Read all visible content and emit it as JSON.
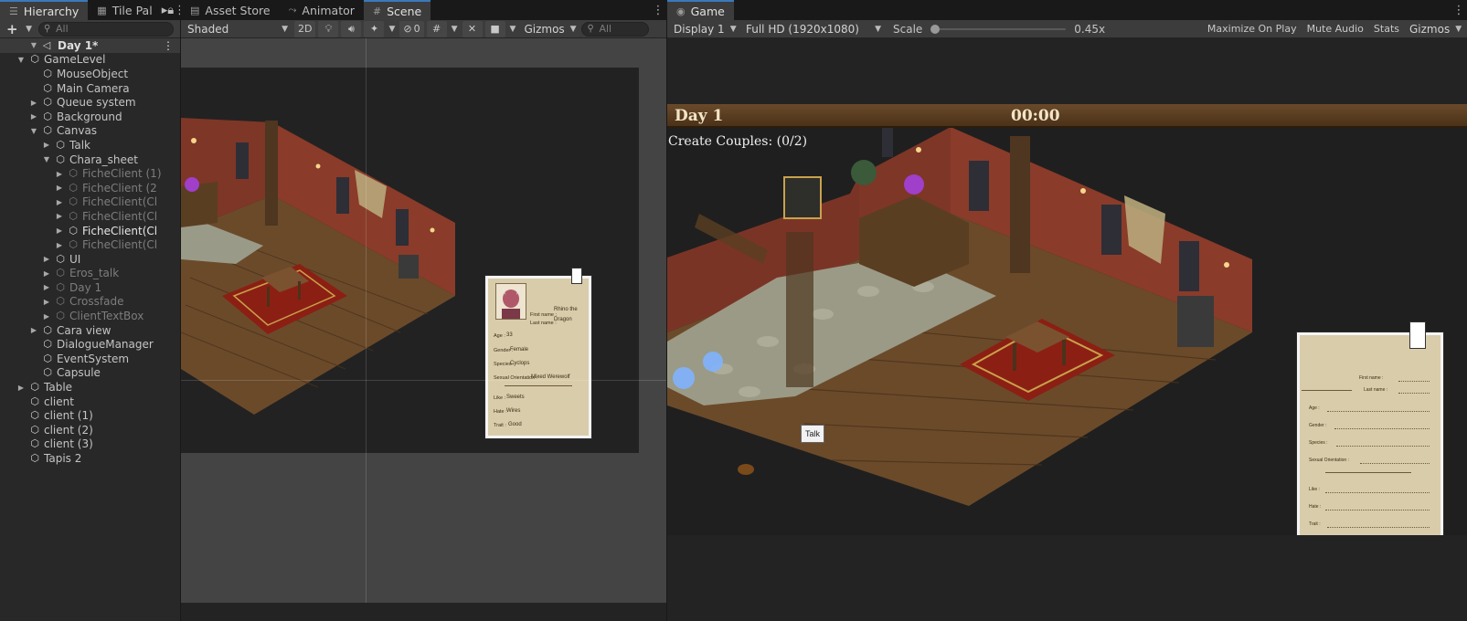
{
  "hierarchy": {
    "tabs": [
      {
        "label": "Hierarchy",
        "icon": "list-icon"
      },
      {
        "label": "Tile Pal",
        "icon": "grid-icon"
      }
    ],
    "add_label": "+",
    "search_placeholder": "All",
    "scene_name": "Day 1*",
    "rows": [
      {
        "label": "GameLevel",
        "depth": 1,
        "expand": "open",
        "state": "normal"
      },
      {
        "label": "MouseObject",
        "depth": 2,
        "expand": "none",
        "state": "normal"
      },
      {
        "label": "Main Camera",
        "depth": 2,
        "expand": "none",
        "state": "normal"
      },
      {
        "label": "Queue system",
        "depth": 2,
        "expand": "closed",
        "state": "normal"
      },
      {
        "label": "Background",
        "depth": 2,
        "expand": "closed",
        "state": "normal"
      },
      {
        "label": "Canvas",
        "depth": 2,
        "expand": "open",
        "state": "normal"
      },
      {
        "label": "Talk",
        "depth": 3,
        "expand": "closed",
        "state": "normal"
      },
      {
        "label": "Chara_sheet",
        "depth": 3,
        "expand": "open",
        "state": "normal"
      },
      {
        "label": "FicheClient (1)",
        "depth": 4,
        "expand": "closed",
        "state": "dim"
      },
      {
        "label": "FicheClient (2",
        "depth": 4,
        "expand": "closed",
        "state": "dim"
      },
      {
        "label": "FicheClient(Cl",
        "depth": 4,
        "expand": "closed",
        "state": "dim"
      },
      {
        "label": "FicheClient(Cl",
        "depth": 4,
        "expand": "closed",
        "state": "dim"
      },
      {
        "label": "FicheClient(Cl",
        "depth": 4,
        "expand": "closed",
        "state": "bright"
      },
      {
        "label": "FicheClient(Cl",
        "depth": 4,
        "expand": "closed",
        "state": "dim"
      },
      {
        "label": "UI",
        "depth": 3,
        "expand": "closed",
        "state": "normal"
      },
      {
        "label": "Eros_talk",
        "depth": 3,
        "expand": "closed",
        "state": "dim"
      },
      {
        "label": "Day 1",
        "depth": 3,
        "expand": "closed",
        "state": "dim"
      },
      {
        "label": "Crossfade",
        "depth": 3,
        "expand": "closed",
        "state": "dim"
      },
      {
        "label": "ClientTextBox",
        "depth": 3,
        "expand": "closed",
        "state": "dim"
      },
      {
        "label": "Cara view",
        "depth": 2,
        "expand": "closed",
        "state": "normal"
      },
      {
        "label": "DialogueManager",
        "depth": 2,
        "expand": "none",
        "state": "normal"
      },
      {
        "label": "EventSystem",
        "depth": 2,
        "expand": "none",
        "state": "normal"
      },
      {
        "label": "Capsule",
        "depth": 2,
        "expand": "none",
        "state": "normal"
      },
      {
        "label": "Table",
        "depth": 1,
        "expand": "closed",
        "state": "normal"
      },
      {
        "label": "client",
        "depth": 1,
        "expand": "none",
        "state": "normal"
      },
      {
        "label": "client (1)",
        "depth": 1,
        "expand": "none",
        "state": "normal"
      },
      {
        "label": "client (2)",
        "depth": 1,
        "expand": "none",
        "state": "normal"
      },
      {
        "label": "client (3)",
        "depth": 1,
        "expand": "none",
        "state": "normal"
      },
      {
        "label": "Tapis 2",
        "depth": 1,
        "expand": "none",
        "state": "normal"
      }
    ]
  },
  "scene": {
    "tabs": [
      {
        "label": "Asset Store",
        "icon": "store-icon"
      },
      {
        "label": "Animator",
        "icon": "animator-icon"
      },
      {
        "label": "Scene",
        "icon": "scene-grid-icon"
      }
    ],
    "shading_mode": "Shaded",
    "mode_2d_label": "2D",
    "hidden_count": "0",
    "gizmos_label": "Gizmos",
    "search_placeholder": "All",
    "sheet": {
      "first_name_label": "First name :",
      "first_name_value": "Rhino the",
      "last_name_label": "Last name :",
      "last_name_value": "Dragon",
      "age_label": "Age :",
      "age_value": "33",
      "gender_label": "Gender :",
      "gender_value": "Female",
      "species_label": "Species :",
      "species_value": "Cyclops",
      "orientation_label": "Sexual Orientation :",
      "orientation_value": "Mixed Werewolf",
      "like_label": "Like :",
      "like_value": "Sweets",
      "hate_label": "Hate :",
      "hate_value": "Wires",
      "trait_label": "Trait :",
      "trait_value": "Good"
    }
  },
  "game": {
    "tab_label": "Game",
    "display_label": "Display 1",
    "resolution_label": "Full HD (1920x1080)",
    "scale_label": "Scale",
    "scale_value": "0.45x",
    "scale_level": 0.0,
    "maximize_label": "Maximize On Play",
    "mute_label": "Mute Audio",
    "stats_label": "Stats",
    "gizmos_label": "Gizmos",
    "hud_day": "Day 1",
    "hud_time": "00:00",
    "objective": "Create Couples: (0/2)",
    "talk_label": "Talk",
    "sheet": {
      "first_name_label": "First name :",
      "last_name_label": "Last name :",
      "age_label": "Age :",
      "gender_label": "Gender :",
      "species_label": "Species :",
      "orientation_label": "Sexual Orientation :",
      "like_label": "Like :",
      "hate_label": "Hate :",
      "trait_label": "Trait :"
    }
  },
  "colors": {
    "panel_bg": "#282828",
    "toolbar_bg": "#3c3c3c",
    "active_tab_accent": "#3a79bb",
    "hud_wood": "#5b3d20",
    "room_wall": "#8a3b2a",
    "floor_wood": "#6b4a2a",
    "rug_red": "#8c1f14",
    "paper": "#d9ccaa"
  }
}
